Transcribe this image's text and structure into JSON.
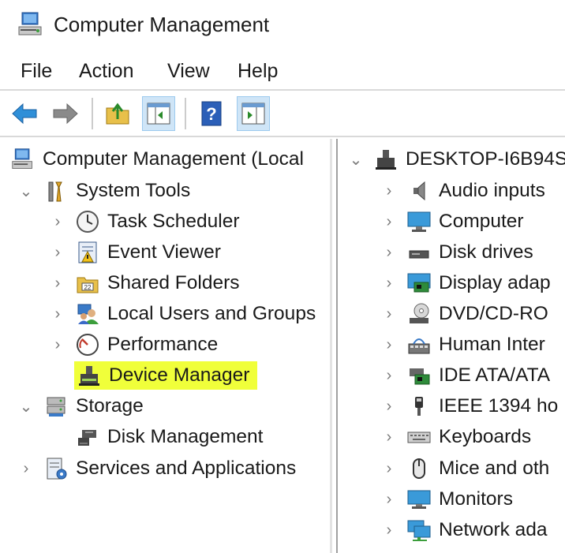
{
  "window": {
    "title": "Computer Management"
  },
  "menu": [
    "File",
    "Action",
    "View",
    "Help"
  ],
  "toolbar": {
    "buttons": [
      "back-arrow-icon",
      "forward-arrow-icon",
      "up-folder-icon",
      "show-hide-tree-icon",
      "help-icon",
      "show-hide-action-pane-icon"
    ]
  },
  "tree": {
    "root": "Computer Management (Local",
    "system_tools": "System Tools",
    "task_scheduler": "Task Scheduler",
    "event_viewer": "Event Viewer",
    "shared_folders": "Shared Folders",
    "local_users": "Local Users and Groups",
    "performance": "Performance",
    "device_manager": "Device Manager",
    "storage": "Storage",
    "disk_management": "Disk Management",
    "services": "Services and Applications"
  },
  "devices": {
    "root": "DESKTOP-I6B94S",
    "items": [
      "Audio inputs",
      "Computer",
      "Disk drives",
      "Display adap",
      "DVD/CD-RO",
      "Human Inter",
      "IDE ATA/ATA",
      "IEEE 1394 ho",
      "Keyboards",
      "Mice and oth",
      "Monitors",
      "Network ada"
    ]
  },
  "colors": {
    "highlight": "#f0ff3a",
    "toolbar_active": "#cfe5f7",
    "arrow_blue": "#2f8fd8"
  }
}
